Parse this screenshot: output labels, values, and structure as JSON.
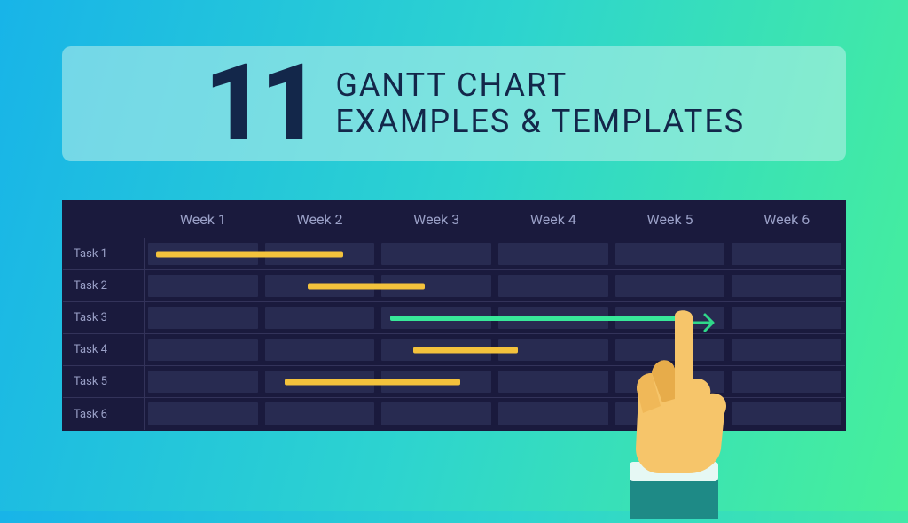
{
  "title": {
    "number": "11",
    "line1": "GANTT CHART",
    "line2": "EXAMPLES & TEMPLATES"
  },
  "chart_data": {
    "type": "gantt",
    "title": "",
    "columns": [
      "Week 1",
      "Week 2",
      "Week 3",
      "Week 4",
      "Week 5",
      "Week 6"
    ],
    "tasks": [
      {
        "name": "Task 1",
        "start": 0.1,
        "end": 1.7,
        "color": "yellow"
      },
      {
        "name": "Task 2",
        "start": 1.4,
        "end": 2.4,
        "color": "yellow"
      },
      {
        "name": "Task 3",
        "start": 2.1,
        "end": 4.7,
        "color": "green"
      },
      {
        "name": "Task 4",
        "start": 2.3,
        "end": 3.2,
        "color": "yellow"
      },
      {
        "name": "Task 5",
        "start": 1.2,
        "end": 2.7,
        "color": "yellow"
      },
      {
        "name": "Task 6",
        "start": null,
        "end": null,
        "color": null
      }
    ],
    "xunit": "weeks",
    "xlim": [
      0,
      6
    ]
  },
  "colors": {
    "chart_bg": "#1A1A3D",
    "cell_bg": "#282B51",
    "bar_yellow": "#F3C23C",
    "bar_green": "#38E899",
    "text_muted": "#9aa0c7"
  }
}
